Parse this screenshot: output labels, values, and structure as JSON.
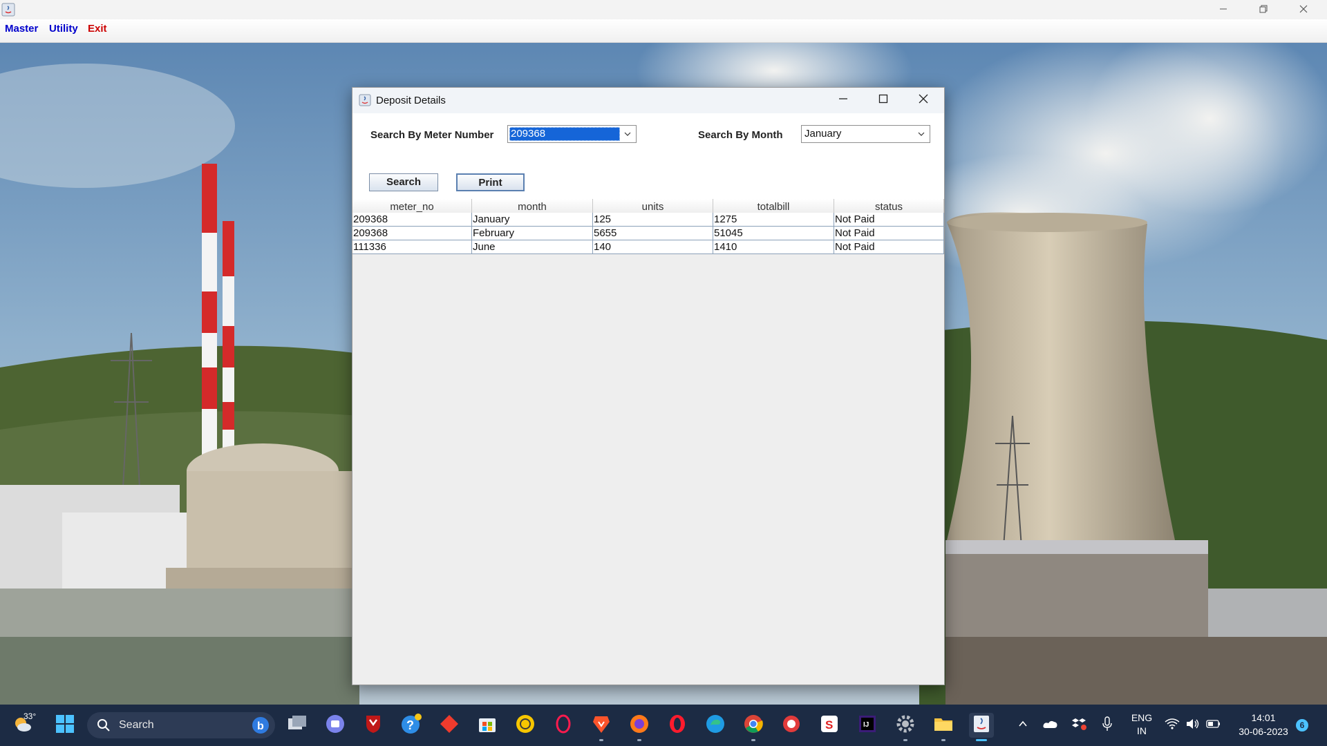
{
  "app": {
    "menu": [
      {
        "label": "Master",
        "color": "#0000cc"
      },
      {
        "label": "Utility",
        "color": "#0000cc"
      },
      {
        "label": "Exit",
        "color": "#cc0000"
      }
    ]
  },
  "dialog": {
    "title": "Deposit Details",
    "meter_label": "Search By Meter Number",
    "meter_selected": "209368",
    "month_label": "Search By Month",
    "month_selected": "January",
    "search_button": "Search",
    "print_button": "Print"
  },
  "table": {
    "columns": [
      "meter_no",
      "month",
      "units",
      "totalbill",
      "status"
    ],
    "rows": [
      [
        "209368",
        "January",
        "125",
        "1275",
        "Not Paid"
      ],
      [
        "209368",
        "February",
        "5655",
        "51045",
        "Not Paid"
      ],
      [
        "111336",
        "June",
        "140",
        "1410",
        "Not Paid"
      ]
    ]
  },
  "taskbar": {
    "weather_temp": "33°",
    "search_placeholder": "Search",
    "language": "ENG",
    "region": "IN",
    "time": "14:01",
    "date": "30-06-2023",
    "notification_count": "6"
  },
  "colors": {
    "selection": "#1565d8",
    "taskbar": "#1c2b44",
    "menu_blue": "#0000cc",
    "menu_red": "#cc0000"
  }
}
